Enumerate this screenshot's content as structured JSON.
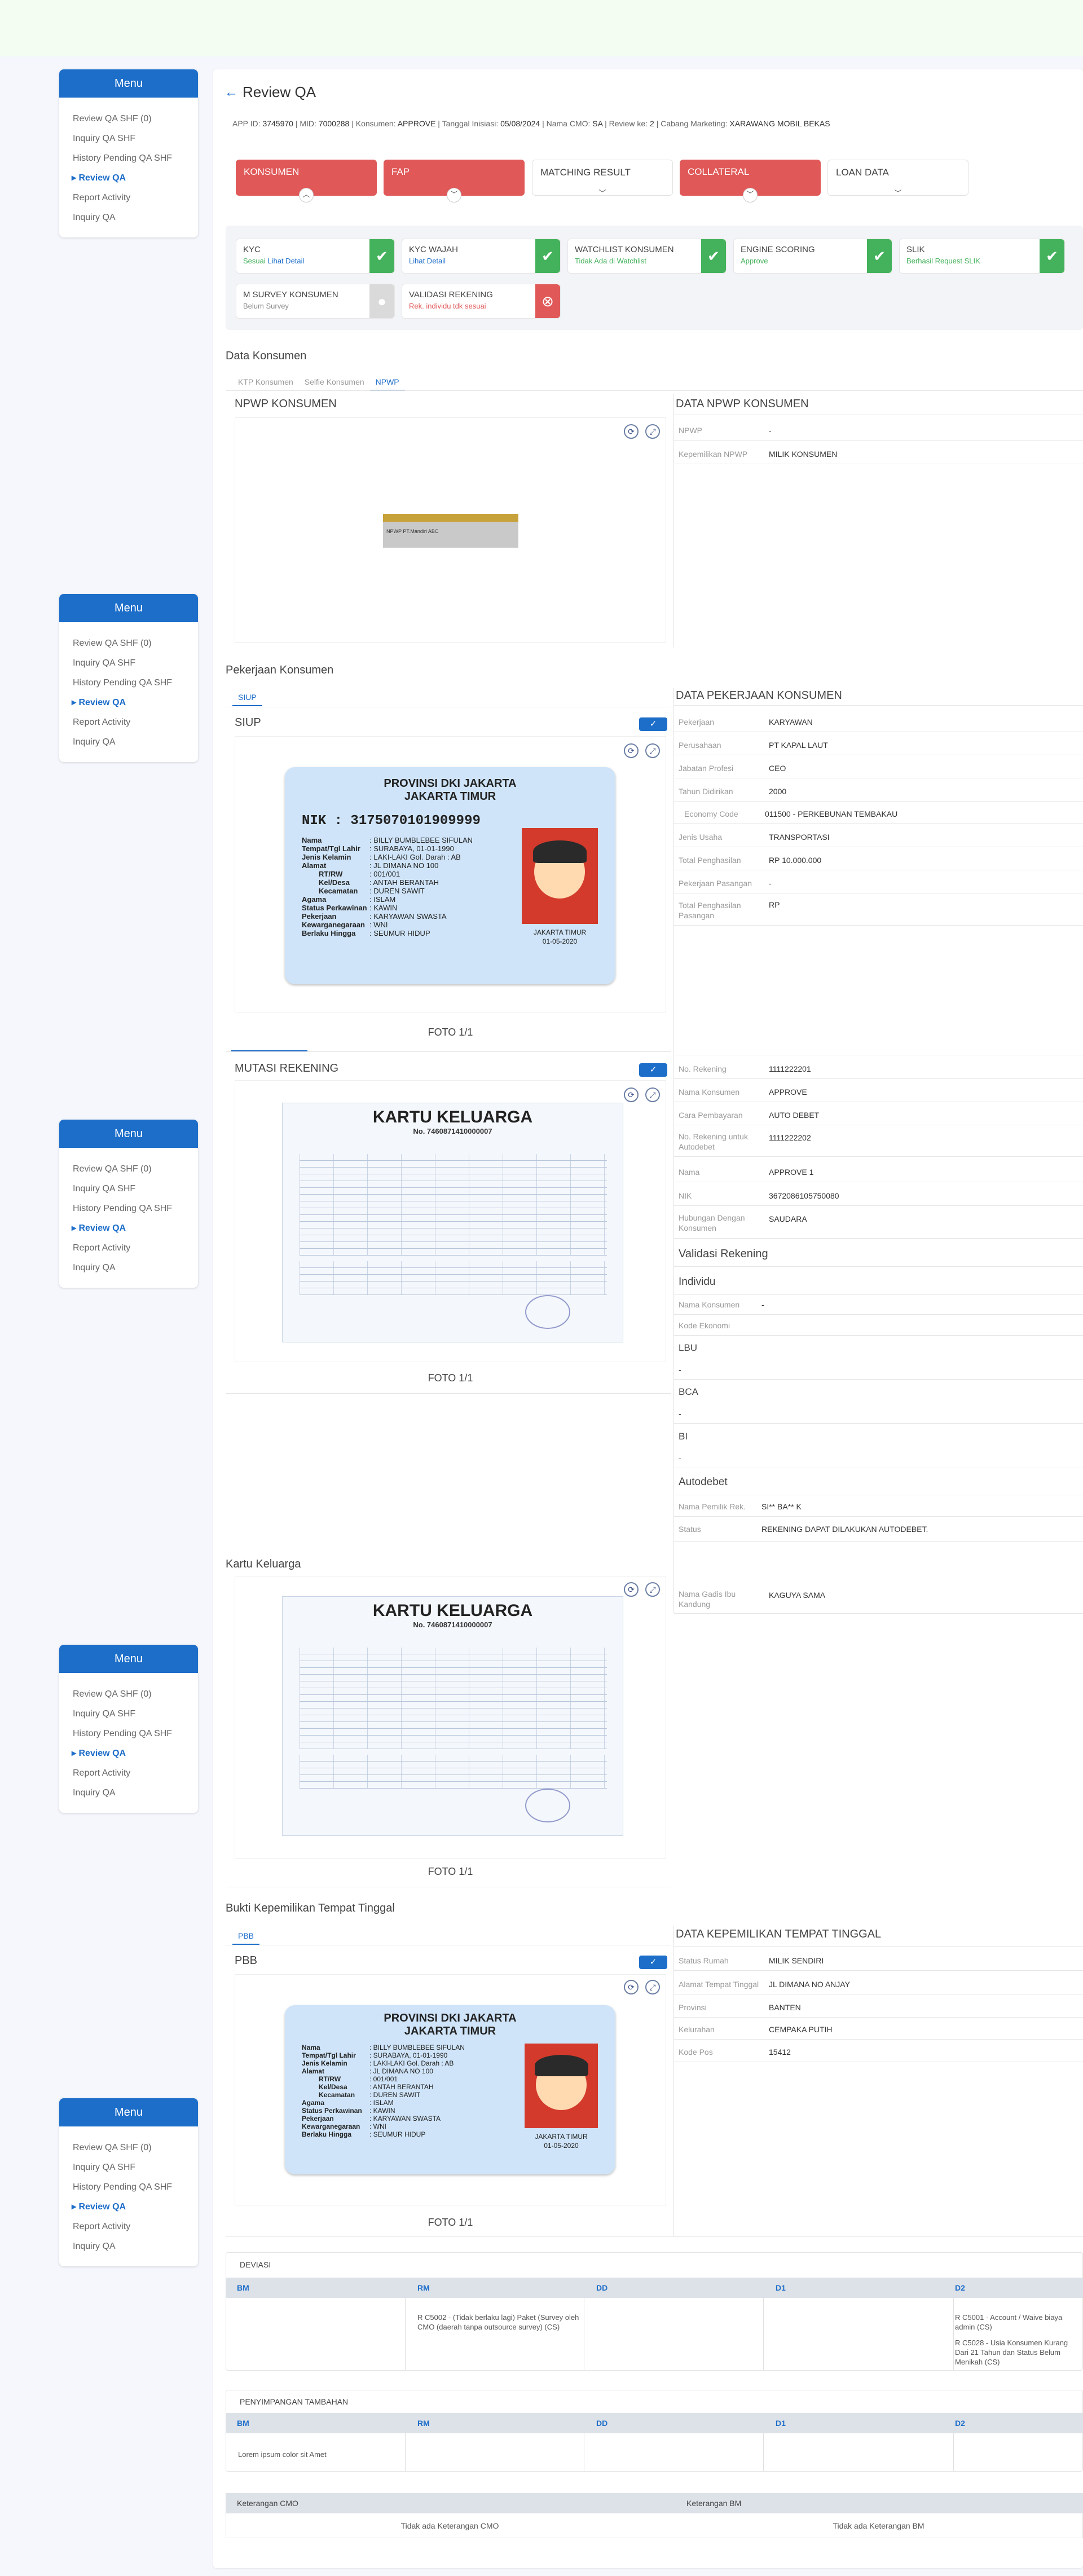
{
  "menu": {
    "title": "Menu",
    "items": [
      "Review QA SHF (0)",
      "Inquiry QA SHF",
      "History Pending QA SHF",
      "Review QA",
      "Report Activity",
      "Inquiry QA"
    ]
  },
  "header": {
    "title": "Review QA",
    "info_label": "APP ID:",
    "app_id": "3745970",
    "mid_label": "MID:",
    "mid": "7000288",
    "konsumen_label": "Konsumen:",
    "konsumen": "APPROVE",
    "tgl_label": "Tanggal Inisiasi:",
    "tgl": "05/08/2024",
    "cmo_label": "Nama CMO:",
    "cmo": "SA",
    "review_label": "Review ke:",
    "review": "2",
    "cabang_label": "Cabang Marketing:",
    "cabang": "XARAWANG MOBIL BEKAS"
  },
  "steps": [
    "KONSUMEN",
    "FAP",
    "MATCHING RESULT",
    "COLLATERAL",
    "LOAN DATA"
  ],
  "checks": [
    {
      "title": "KYC",
      "status": "Sesuai",
      "link": "Lihat Detail"
    },
    {
      "title": "KYC WAJAH",
      "status": "Lihat Detail"
    },
    {
      "title": "WATCHLIST KONSUMEN",
      "status": "Tidak Ada di Watchlist"
    },
    {
      "title": "ENGINE SCORING",
      "status": "Approve"
    },
    {
      "title": "SLIK",
      "status": "Berhasil Request SLIK"
    },
    {
      "title": "M SURVEY KONSUMEN",
      "status": "Belum Survey"
    },
    {
      "title": "VALIDASI REKENING",
      "status": "Rek. individu tdk sesuai"
    }
  ],
  "data_konsumen": {
    "title": "Data Konsumen",
    "tabs": [
      "KTP Konsumen",
      "Selfie Konsumen",
      "NPWP"
    ],
    "left_title": "NPWP KONSUMEN",
    "right_title": "DATA NPWP KONSUMEN",
    "npwp_label": "NPWP",
    "npwp": "-",
    "kepemilikan_label": "Kepemilikan NPWP",
    "kepemilikan": "MILIK KONSUMEN",
    "npwp_card": "NPWP  PT.Mandiri ABC"
  },
  "pekerjaan": {
    "title": "Pekerjaan Konsumen",
    "tab": "SIUP",
    "left_title": "SIUP",
    "right_title": "DATA PEKERJAAN KONSUMEN",
    "fields": [
      [
        "Pekerjaan",
        "KARYAWAN"
      ],
      [
        "Perusahaan",
        "PT KAPAL LAUT"
      ],
      [
        "Jabatan Profesi",
        "CEO"
      ],
      [
        "Tahun Didirikan",
        "2000"
      ],
      [
        "Economy Code",
        "011500 - PERKEBUNAN TEMBAKAU"
      ],
      [
        "Jenis Usaha",
        "TRANSPORTASI"
      ],
      [
        "Total Penghasilan",
        "RP 10.000.000"
      ],
      [
        "Pekerjaan Pasangan",
        "-"
      ],
      [
        "Total Penghasilan Pasangan",
        "RP"
      ]
    ],
    "foto": "FOTO 1/1"
  },
  "ktp": {
    "prov": "PROVINSI DKI JAKARTA",
    "kota": "JAKARTA TIMUR",
    "nik_label": "NIK",
    "nik": ": 3175070101909999",
    "rows": [
      [
        "Nama",
        ": BILLY BUMBLEBEE SIFULAN"
      ],
      [
        "Tempat/Tgl Lahir",
        ": SURABAYA, 01-01-1990"
      ],
      [
        "Jenis Kelamin",
        ": LAKI-LAKI     Gol. Darah : AB"
      ],
      [
        "Alamat",
        ": JL DIMANA NO 100"
      ],
      [
        "RT/RW",
        ": 001/001"
      ],
      [
        "Kel/Desa",
        ": ANTAH BERANTAH"
      ],
      [
        "Kecamatan",
        ": DUREN SAWIT"
      ],
      [
        "Agama",
        ": ISLAM"
      ],
      [
        "Status Perkawinan",
        ": KAWIN"
      ],
      [
        "Pekerjaan",
        ": KARYAWAN SWASTA"
      ],
      [
        "Kewarganegaraan",
        ": WNI"
      ],
      [
        "Berlaku Hingga",
        ": SEUMUR HIDUP"
      ]
    ],
    "place": "JAKARTA TIMUR",
    "date": "01-05-2020"
  },
  "mutasi": {
    "left_title": "MUTASI REKENING",
    "foto": "FOTO 1/1",
    "fields": [
      [
        "No. Rekening",
        "1111222201"
      ],
      [
        "Nama Konsumen",
        "APPROVE"
      ],
      [
        "Cara Pembayaran",
        "AUTO DEBET"
      ],
      [
        "No. Rekening untuk Autodebet",
        "1111222202"
      ],
      [
        "Nama",
        "APPROVE 1"
      ],
      [
        "NIK",
        "3672086105750080"
      ],
      [
        "Hubungan Dengan Konsumen",
        "SAUDARA"
      ]
    ],
    "validasi_title": "Validasi Rekening",
    "individu": "Individu",
    "nama_konsumen_label": "Nama Konsumen",
    "nama_konsumen": "-",
    "kode_ekonomi_label": "Kode Ekonomi",
    "lbu": "LBU",
    "lbu_v": "-",
    "bca": "BCA",
    "bca_v": "-",
    "bi": "BI",
    "bi_v": "-",
    "autodebet": "Autodebet",
    "pemilik_label": "Nama Pemilik Rek.",
    "pemilik": "SI** BA** K",
    "status_label": "Status",
    "status": "REKENING DAPAT DILAKUKAN AUTODEBET."
  },
  "kk": {
    "title": "Kartu Keluarga",
    "doc_title": "KARTU KELUARGA",
    "doc_no": "No. 7460871410000007",
    "foto": "FOTO 1/1",
    "ibu_label": "Nama Gadis Ibu Kandung",
    "ibu": "KAGUYA SAMA"
  },
  "bukti": {
    "title": "Bukti Kepemilikan Tempat Tinggal",
    "tab": "PBB",
    "left_title": "PBB",
    "right_title": "DATA KEPEMILIKAN TEMPAT TINGGAL",
    "fields": [
      [
        "Status Rumah",
        "MILIK SENDIRI"
      ],
      [
        "Alamat Tempat Tinggal",
        "JL DIMANA NO ANJAY"
      ],
      [
        "Provinsi",
        "BANTEN"
      ],
      [
        "Kelurahan",
        "CEMPAKA PUTIH"
      ],
      [
        "Kode Pos",
        "15412"
      ]
    ],
    "foto": "FOTO 1/1"
  },
  "deviasi": {
    "title": "DEVIASI",
    "cols": [
      "BM",
      "RM",
      "DD",
      "D1",
      "D2"
    ],
    "rm_note": "R C5002 - (Tidak berlaku lagi) Paket (Survey oleh CMO (daerah tanpa outsource survey) (CS)",
    "d2_note1": "R C5001 - Account / Waive biaya admin (CS)",
    "d2_note2": "R C5028 - Usia Konsumen Kurang Dari 21 Tahun dan Status Belum Menikah (CS)"
  },
  "penyimpangan": {
    "title": "PENYIMPANGAN TAMBAHAN",
    "cols": [
      "BM",
      "RM",
      "DD",
      "D1",
      "D2"
    ],
    "bm_note": "Lorem ipsum color sit Amet"
  },
  "keterangan": {
    "cmo_label": "Keterangan CMO",
    "bm_label": "Keterangan BM",
    "cmo": "Tidak ada Keterangan CMO",
    "bm": "Tidak ada Keterangan BM"
  },
  "colors": {
    "accent": "#1d6ec9",
    "red": "#e05858",
    "green": "#44b25c"
  }
}
